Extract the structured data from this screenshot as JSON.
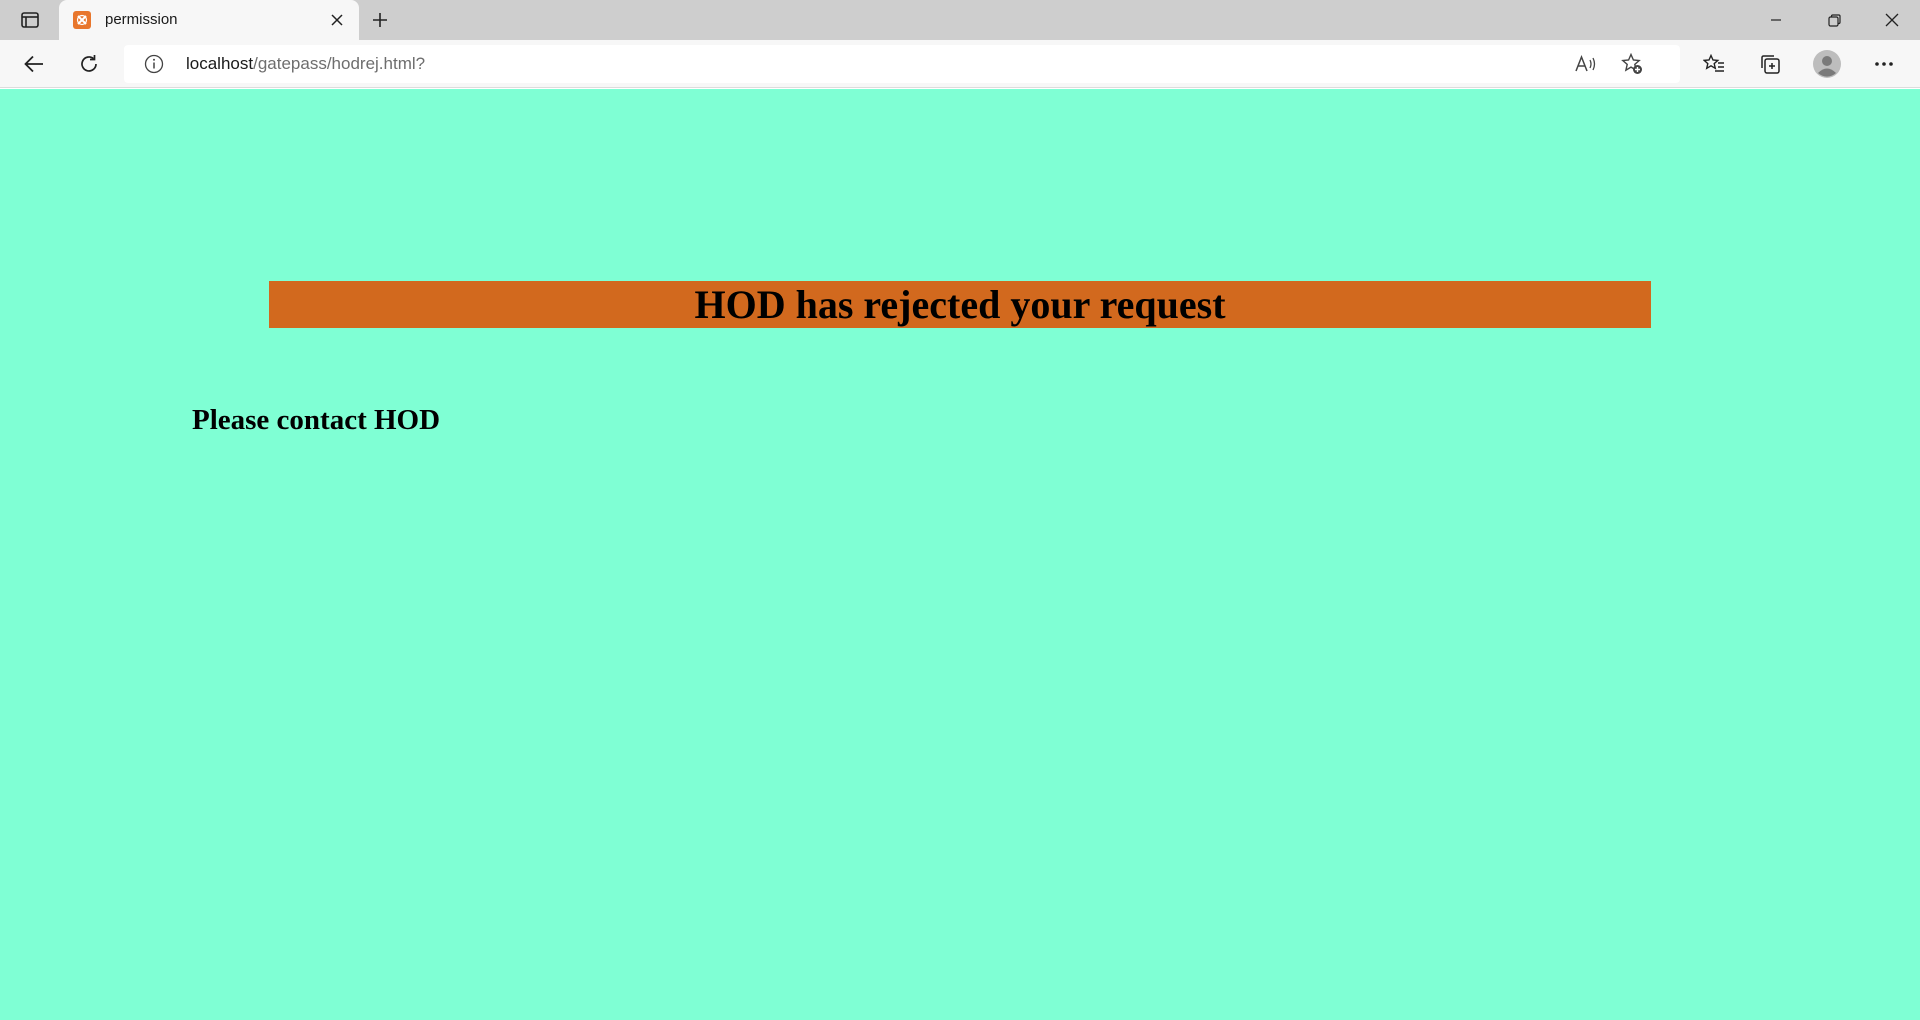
{
  "browser": {
    "tab": {
      "title": "permission",
      "favicon": "xampp-favicon"
    },
    "address": {
      "host": "localhost",
      "path": "/gatepass/hodrej.html?"
    }
  },
  "page": {
    "heading": "HOD has rejected your request",
    "message": "Please contact HOD"
  },
  "colors": {
    "page_background": "#7fffd4",
    "banner_background": "#d2691e",
    "favicon": "#e8762c"
  }
}
